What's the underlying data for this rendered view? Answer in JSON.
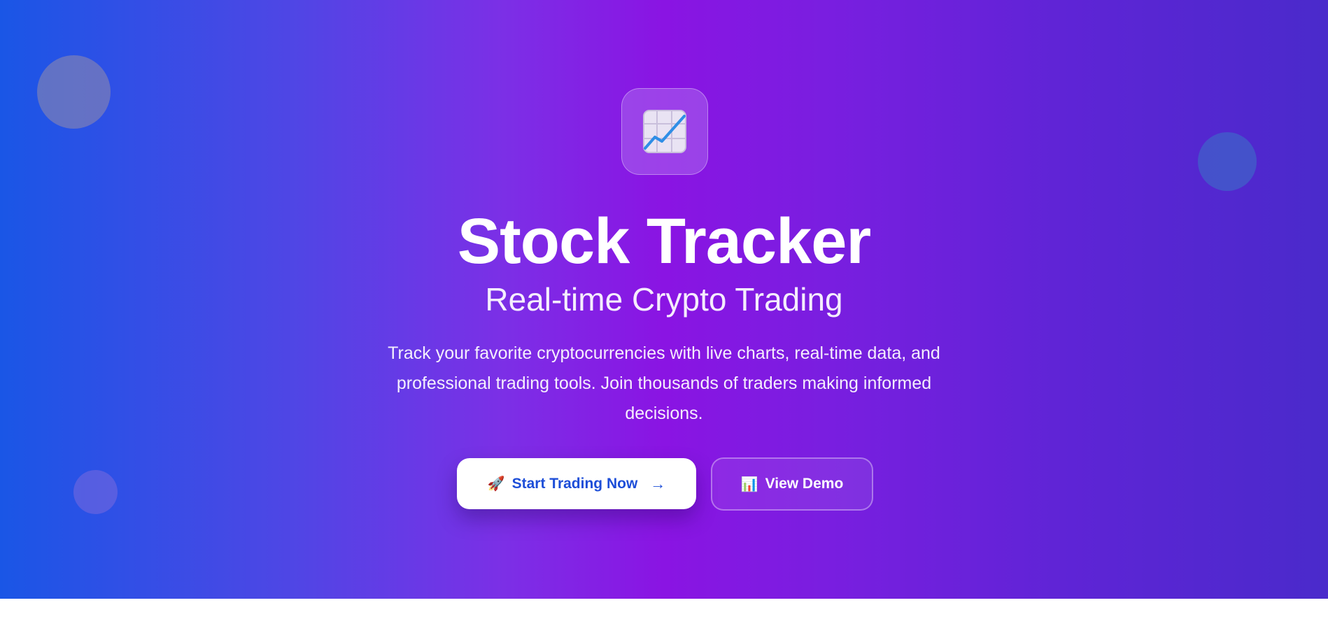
{
  "hero": {
    "title": "Stock Tracker",
    "subtitle": "Real-time Crypto Trading",
    "description": "Track your favorite cryptocurrencies with live charts, real-time data, and professional trading tools. Join thousands of traders making informed decisions.",
    "logo_icon": "chart-increasing-icon"
  },
  "actions": {
    "primary": {
      "icon": "rocket-icon",
      "icon_glyph": "🚀",
      "label": "Start Trading Now",
      "arrow_icon": "arrow-right-icon",
      "arrow_glyph": "→"
    },
    "secondary": {
      "icon": "bar-chart-icon",
      "icon_glyph": "📊",
      "label": "View Demo"
    }
  },
  "colors": {
    "gradient_start": "#1a56e6",
    "gradient_mid": "#8a14e3",
    "gradient_end": "#4a2acb",
    "primary_button_text": "#1d4ed8"
  }
}
